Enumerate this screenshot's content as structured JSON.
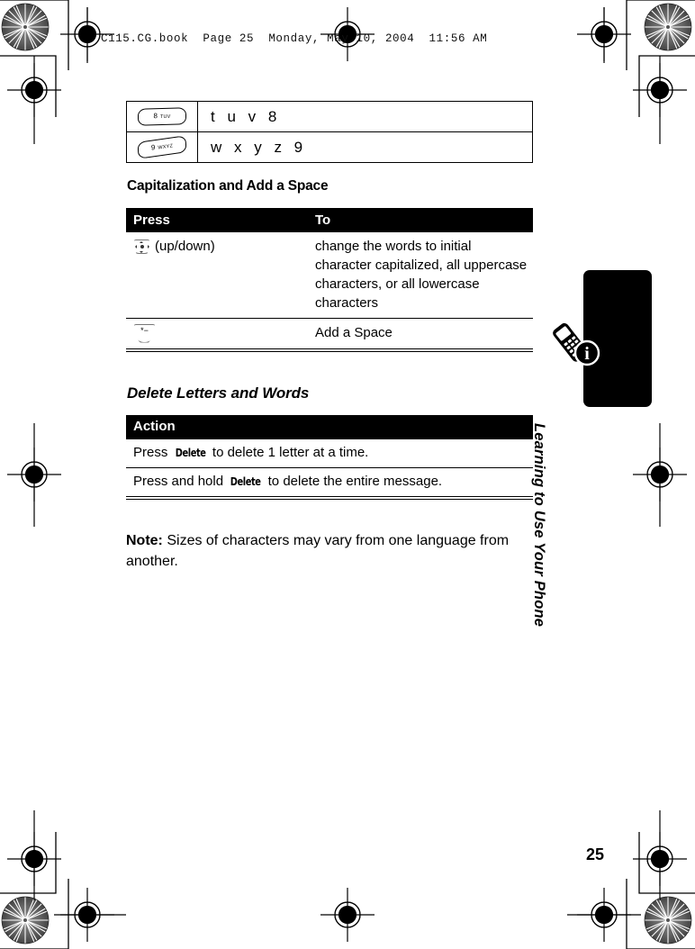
{
  "document": {
    "header_line": "C115.CG.book  Page 25  Monday, May 10, 2004  11:56 AM",
    "page_number": "25"
  },
  "key_letters_table": {
    "rows": [
      {
        "key_icon": "key-8-tuv-icon",
        "key_digit": "8",
        "key_sub": "TUV",
        "letters": "t  u  v  8"
      },
      {
        "key_icon": "key-9-wxyz-icon",
        "key_digit": "9",
        "key_sub": "WXYZ",
        "letters": "w  x  y  z  9"
      }
    ]
  },
  "capitalization_section": {
    "heading": "Capitalization and Add a Space",
    "table": {
      "headers": {
        "press": "Press",
        "to": "To"
      },
      "rows": [
        {
          "key_icon": "nav-key-up-down-icon",
          "press_label": "(up/down)",
          "to": "change the words to initial character capitalized, all uppercase characters, or all lowercase characters"
        },
        {
          "key_icon": "star-key-icon",
          "press_label": "",
          "to": "Add a Space"
        }
      ]
    }
  },
  "delete_section": {
    "heading": "Delete Letters and Words",
    "table": {
      "header": "Action",
      "rows": [
        {
          "prefix": "Press ",
          "softkey": "Delete",
          "suffix": " to delete 1 letter at a time."
        },
        {
          "prefix": "Press and hold ",
          "softkey": "Delete",
          "suffix": " to delete the entire message."
        }
      ]
    }
  },
  "note": {
    "label": "Note:",
    "text": " Sizes of characters may vary from one language from another."
  },
  "side_tab": {
    "label": "Learning to Use Your Phone",
    "icon": "phone-info-icon",
    "color": "#000000"
  },
  "colors": {
    "page_background": "#ffffff",
    "text": "#000000",
    "table_header_background": "#000000",
    "table_header_text": "#ffffff",
    "rule": "#000000"
  }
}
